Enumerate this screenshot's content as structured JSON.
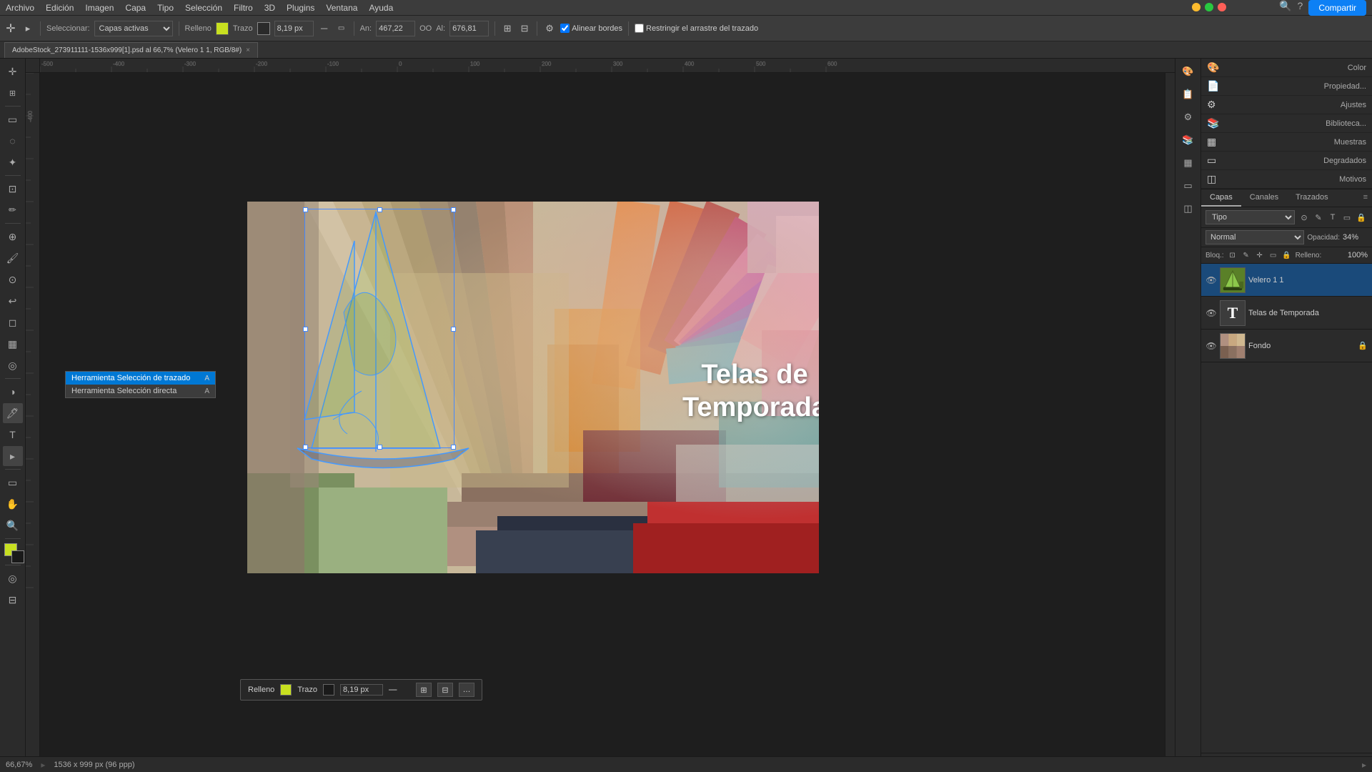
{
  "menu": {
    "items": [
      "Archivo",
      "Edición",
      "Imagen",
      "Capa",
      "Tipo",
      "Selección",
      "Filtro",
      "3D",
      "Plugins",
      "Ventana",
      "Ayuda"
    ]
  },
  "window_controls": {
    "close": "×",
    "minimize": "−",
    "maximize": "□"
  },
  "toolbar": {
    "seleccionar_label": "Seleccionar:",
    "capas_activas": "Capas activas",
    "relleno_label": "Relleno",
    "trazo_label": "Trazo",
    "stroke_size": "8,19 px",
    "an_label": "An:",
    "an_value": "467,22",
    "oo_label": "OO",
    "al_label": "Al:",
    "al_value": "676,81",
    "alinear_bordes": "Alinear bordes",
    "restringir_arrastre": "Restringir el arrastre del trazado",
    "compartir": "Compartir"
  },
  "tab": {
    "title": "AdobeStock_273911111-1536x999[1].psd al 66,7% (Velero 1 1, RGB/8#)",
    "close_icon": "×"
  },
  "canvas": {
    "zoom": "66,67%",
    "size": "1536 x 999 px (96 ppp)"
  },
  "canvas_text": {
    "line1": "Telas de",
    "line2": "Temporada"
  },
  "context_bar": {
    "relleno_label": "Relleno",
    "trazo_label": "Trazo",
    "stroke_size": "8,19 px",
    "btn1": "⊞",
    "btn2": "⊟",
    "btn3": "…"
  },
  "tool_tooltip": {
    "items": [
      {
        "label": "Herramienta Selección de trazado",
        "key": "A",
        "active": true
      },
      {
        "label": "Herramienta Selección directa",
        "key": "A",
        "active": false
      }
    ]
  },
  "layers_panel": {
    "tabs": [
      "Capas",
      "Canales",
      "Trazados"
    ],
    "active_tab": "Capas",
    "search_placeholder": "Tipo",
    "blend_mode": "Normal",
    "opacity_label": "Opacidad:",
    "opacity_value": "34%",
    "bloqueo_label": "Bloq.:",
    "fill_label": "Relleno:",
    "fill_value": "100%",
    "layers": [
      {
        "name": "Velero 1 1",
        "type": "vector",
        "visible": true,
        "locked": false
      },
      {
        "name": "Telas de Temporada",
        "type": "text",
        "visible": true,
        "locked": false
      },
      {
        "name": "Fondo",
        "type": "image",
        "visible": true,
        "locked": true
      }
    ]
  },
  "right_panel_icons": {
    "icons": [
      "🎨",
      "📋",
      "⚙️",
      "📚",
      "▦",
      "▭",
      "🎭"
    ]
  },
  "right_props": {
    "color_label": "Color",
    "propiedad_label": "Propiedad...",
    "ajustes_label": "Ajustes",
    "bibliotecas_label": "Biblioteca...",
    "muestras_label": "Muestras",
    "degradados_label": "Degradados",
    "motivos_label": "Motivos"
  },
  "status_bar": {
    "zoom": "66,67%",
    "size": "1536 x 999 px (96 ppp)"
  }
}
